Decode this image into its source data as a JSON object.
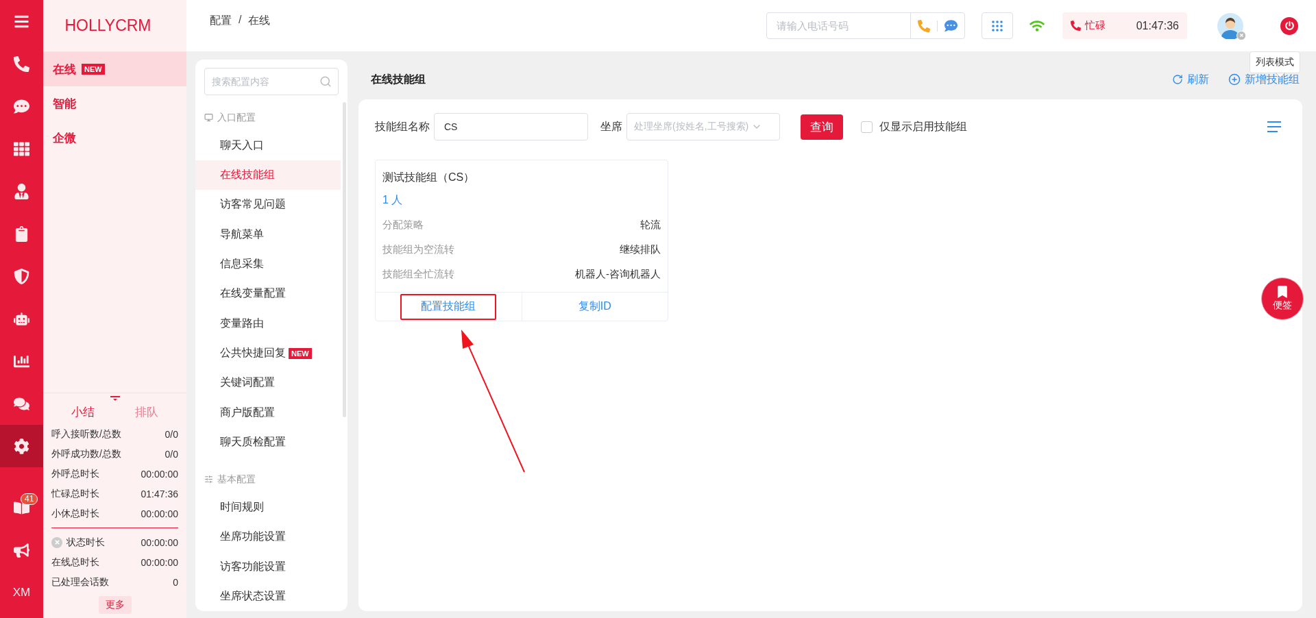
{
  "rail": {
    "items": [
      {
        "selected": false
      },
      {
        "selected": false
      },
      {
        "selected": false
      },
      {
        "selected": false
      },
      {
        "selected": false
      },
      {
        "selected": false
      },
      {
        "selected": false
      },
      {
        "selected": false
      },
      {
        "selected": false
      },
      {
        "selected": false
      },
      {
        "selected": true
      }
    ],
    "badge": "41",
    "initials": "XM"
  },
  "brand": {
    "name": "HOLLYCRM"
  },
  "modules": [
    {
      "label": "在线",
      "badge": "NEW",
      "selected": true
    },
    {
      "label": "智能",
      "selected": false
    },
    {
      "label": "企微",
      "selected": false
    }
  ],
  "summary": {
    "tabs": [
      {
        "label": "小结",
        "selected": true
      },
      {
        "label": "排队",
        "selected": false
      }
    ],
    "rows": [
      {
        "label": "呼入接听数/总数",
        "value": "0/0"
      },
      {
        "label": "外呼成功数/总数",
        "value": "0/0"
      },
      {
        "label": "外呼总时长",
        "value": "00:00:00"
      },
      {
        "label": "忙碌总时长",
        "value": "01:47:36"
      },
      {
        "label": "小休总时长",
        "value": "00:00:00"
      }
    ],
    "status_rows": [
      {
        "label": "状态时长",
        "value": "00:00:00",
        "kind": "status"
      },
      {
        "label": "在线总时长",
        "value": "00:00:00",
        "kind": "plain"
      },
      {
        "label": "已处理会话数",
        "value": "0",
        "kind": "plain"
      }
    ],
    "more_button": "更多"
  },
  "breadcrumb": {
    "items": [
      "配置",
      "在线"
    ],
    "separator": "/"
  },
  "topbar": {
    "phone_placeholder": "请输入电话号码",
    "status": "忙碌",
    "timer": "01:47:36"
  },
  "config_menu": {
    "search_placeholder": "搜索配置内容",
    "sections": [
      {
        "title": "入口配置",
        "kind": "entry",
        "items": [
          {
            "label": "聊天入口",
            "selected": false
          },
          {
            "label": "在线技能组",
            "selected": true
          },
          {
            "label": "访客常见问题",
            "selected": false
          },
          {
            "label": "导航菜单",
            "selected": false
          },
          {
            "label": "信息采集",
            "selected": false
          },
          {
            "label": "在线变量配置",
            "selected": false
          },
          {
            "label": "变量路由",
            "selected": false
          },
          {
            "label": "公共快捷回复",
            "badge": "NEW",
            "selected": false
          },
          {
            "label": "关键词配置",
            "selected": false
          },
          {
            "label": "商户版配置",
            "selected": false
          },
          {
            "label": "聊天质检配置",
            "selected": false
          }
        ]
      },
      {
        "title": "基本配置",
        "kind": "basic",
        "items": [
          {
            "label": "时间规则",
            "selected": false
          },
          {
            "label": "坐席功能设置",
            "selected": false
          },
          {
            "label": "访客功能设置",
            "selected": false
          },
          {
            "label": "坐席状态设置",
            "selected": false
          }
        ]
      }
    ]
  },
  "page": {
    "title": "在线技能组",
    "actions": [
      {
        "label": "刷新",
        "kind": "refresh"
      },
      {
        "label": "新增技能组",
        "kind": "add"
      }
    ],
    "tooltip": "列表模式"
  },
  "filters": {
    "name_label": "技能组名称",
    "name_value": "CS",
    "agent_label": "坐席",
    "agent_placeholder": "处理坐席(按姓名,工号搜索)",
    "query_button": "查询",
    "only_enabled": {
      "label": "仅显示启用技能组",
      "checked": false
    }
  },
  "cards": [
    {
      "title": "测试技能组（CS）",
      "members": "1 人",
      "rows": [
        {
          "label": "分配策略",
          "value": "轮流"
        },
        {
          "label": "技能组为空流转",
          "value": "继续排队"
        },
        {
          "label": "技能组全忙流转",
          "value": "机器人-咨询机器人"
        }
      ],
      "buttons": [
        {
          "label": "配置技能组",
          "highlighted": true
        },
        {
          "label": "复制ID",
          "highlighted": false
        }
      ]
    }
  ],
  "note_button": "便签"
}
